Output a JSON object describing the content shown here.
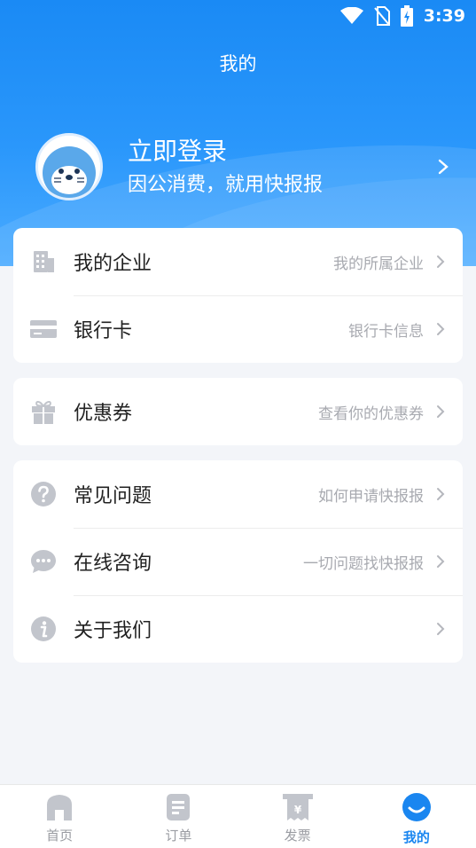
{
  "status_bar": {
    "time": "3:39"
  },
  "header": {
    "title": "我的"
  },
  "profile": {
    "login_label": "立即登录",
    "slogan": "因公消费，就用快报报"
  },
  "menu_groups": [
    {
      "items": [
        {
          "label": "我的企业",
          "hint": "我的所属企业",
          "icon": "building-icon"
        },
        {
          "label": "银行卡",
          "hint": "银行卡信息",
          "icon": "bank-card-icon"
        }
      ]
    },
    {
      "items": [
        {
          "label": "优惠券",
          "hint": "查看你的优惠券",
          "icon": "gift-icon"
        }
      ]
    },
    {
      "items": [
        {
          "label": "常见问题",
          "hint": "如何申请快报报",
          "icon": "question-icon"
        },
        {
          "label": "在线咨询",
          "hint": "一切问题找快报报",
          "icon": "chat-icon"
        },
        {
          "label": "关于我们",
          "hint": "",
          "icon": "info-icon"
        }
      ]
    }
  ],
  "tabbar": {
    "tabs": [
      {
        "label": "首页",
        "icon": "home-icon"
      },
      {
        "label": "订单",
        "icon": "order-icon"
      },
      {
        "label": "发票",
        "icon": "invoice-icon"
      },
      {
        "label": "我的",
        "icon": "profile-icon",
        "active": true
      }
    ]
  },
  "colors": {
    "accent": "#1a86f0",
    "icon_gray": "#c2c5cc"
  }
}
